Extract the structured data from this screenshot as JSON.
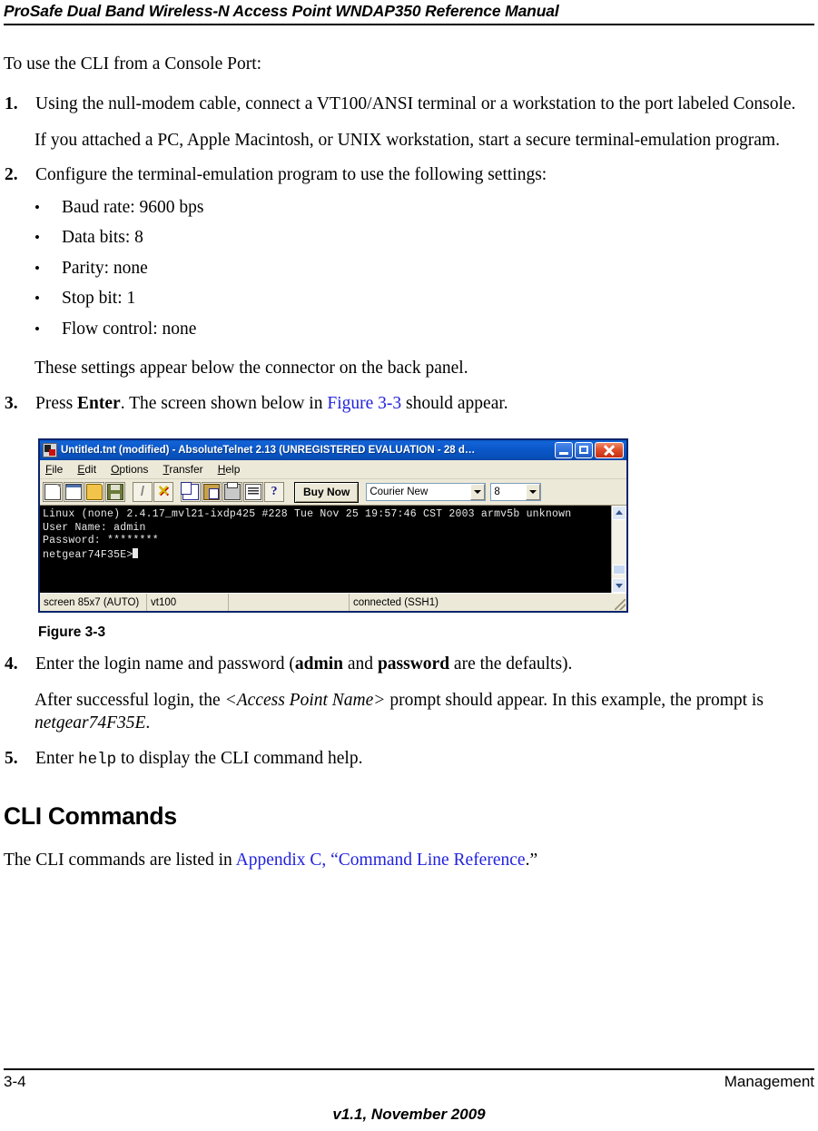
{
  "header": {
    "title": "ProSafe Dual Band Wireless-N Access Point WNDAP350 Reference Manual"
  },
  "content": {
    "intro": "To use the CLI from a Console Port:",
    "steps": [
      {
        "num": "1.",
        "text_before": "Using the null-modem cable, connect a VT100/ANSI terminal or a workstation to the port labeled Console.",
        "sub": "If you attached a PC, Apple Macintosh, or UNIX workstation, start a secure terminal-emulation program."
      },
      {
        "num": "2.",
        "text_before": "Configure the terminal-emulation program to use the following settings:",
        "bullets": [
          "Baud rate: 9600 bps",
          "Data bits: 8",
          "Parity: none",
          "Stop bit: 1",
          "Flow control: none"
        ],
        "sub": "These settings appear below the connector on the back panel."
      },
      {
        "num": "3.",
        "seg1": "Press ",
        "bold1": "Enter",
        "seg2": ". The screen shown below in ",
        "link1": "Figure 3-3",
        "seg3": " should appear."
      },
      {
        "num": "4.",
        "seg1": "Enter the login name and password (",
        "bold1": "admin",
        "seg2": " and ",
        "bold2": "password",
        "seg3": " are the defaults).",
        "sub_seg1": "After successful login, the ",
        "sub_ital1": "<Access Point Name>",
        "sub_seg2": " prompt should appear. In this example, the prompt is ",
        "sub_ital2": "netgear74F35E",
        "sub_seg3": "."
      },
      {
        "num": "5.",
        "seg1": "Enter ",
        "mono1": "help",
        "seg2": " to display the CLI command help."
      }
    ],
    "figure_caption": "Figure 3-3",
    "section_heading": "CLI Commands",
    "section_para_seg1": "The CLI commands are listed in ",
    "section_para_link": "Appendix C, “Command Line Reference",
    "section_para_seg2": ".”"
  },
  "terminal_window": {
    "title": "Untitled.tnt (modified) - AbsoluteTelnet 2.13   (UNREGISTERED EVALUATION - 28 d…",
    "app_icon": "telnet-app-icon",
    "window_controls": [
      {
        "name": "minimize-button",
        "glyph": "_"
      },
      {
        "name": "maximize-button",
        "glyph": "□"
      },
      {
        "name": "close-button",
        "glyph": "✕"
      }
    ],
    "menus": [
      {
        "accel": "F",
        "rest": "ile"
      },
      {
        "accel": "E",
        "rest": "dit"
      },
      {
        "accel": "O",
        "rest": "ptions"
      },
      {
        "accel": "T",
        "rest": "ransfer"
      },
      {
        "accel": "H",
        "rest": "elp"
      }
    ],
    "toolbar": {
      "icons": [
        "new-document-icon",
        "new-window-icon",
        "open-folder-icon",
        "save-icon",
        "connect-icon",
        "disconnect-icon",
        "copy-icon",
        "paste-icon",
        "print-icon",
        "log-icon",
        "help-icon"
      ],
      "buy_now_label": "Buy Now",
      "font_value": "Courier New",
      "font_size_value": "8"
    },
    "screen_lines": [
      "Linux (none) 2.4.17_mvl21-ixdp425 #228 Tue Nov 25 19:57:46 CST 2003 armv5b unknown",
      "User Name: admin",
      "Password: ********",
      "netgear74F35E>"
    ],
    "status": {
      "screen": "screen 85x7 (AUTO)",
      "emulation": "vt100",
      "blank": "",
      "connection": "connected (SSH1)"
    },
    "scrollbar": {
      "up": "scroll-up-arrow",
      "down": "scroll-down-arrow"
    }
  },
  "footer": {
    "page_number": "3-4",
    "chapter": "Management",
    "version": "v1.1, November 2009"
  },
  "colors": {
    "link": "#2222dd",
    "titlebar": "#0a56c8",
    "chrome": "#ece9d8",
    "terminal_bg": "#000000",
    "terminal_fg": "#e8e8e8"
  }
}
